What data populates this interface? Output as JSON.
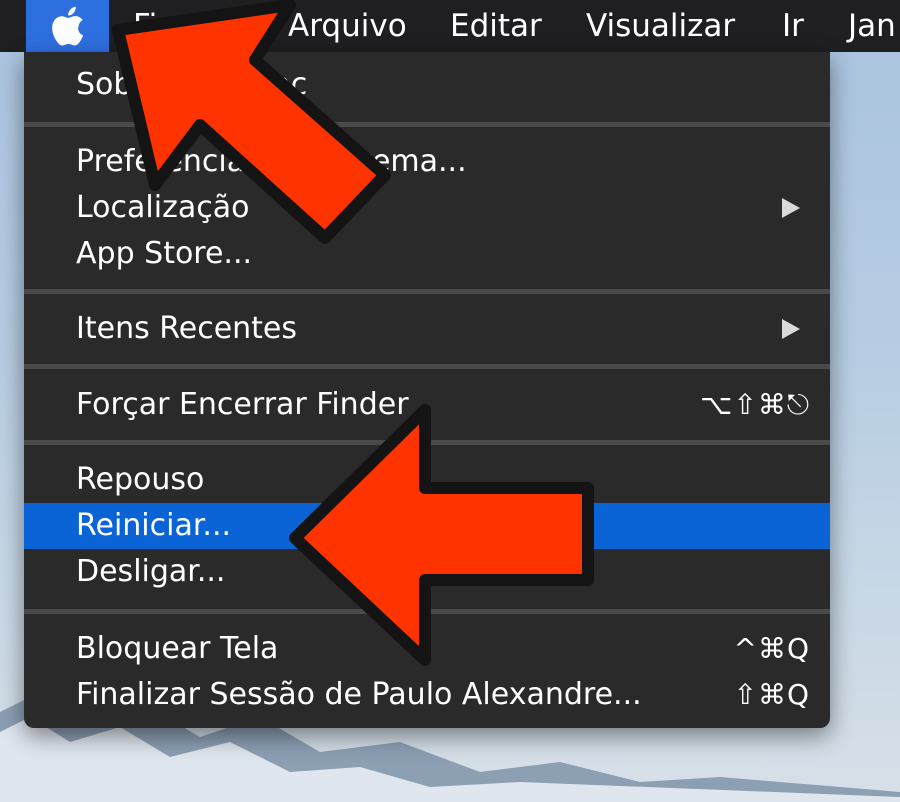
{
  "menubar": {
    "apple_icon": "apple-logo-icon",
    "items": [
      "Fi",
      "Arquivo",
      "Editar",
      "Visualizar",
      "Ir",
      "Jan"
    ]
  },
  "apple_menu": {
    "items": [
      {
        "label": "Sobre Este Mac"
      },
      {
        "label": "Preferências do Sistema..."
      },
      {
        "label": "Localização",
        "submenu": true
      },
      {
        "label": "App Store..."
      },
      {
        "label": "Itens Recentes",
        "submenu": true
      },
      {
        "label": "Forçar Encerrar Finder",
        "shortcut": "⌥⇧⌘⎋"
      },
      {
        "label": "Repouso"
      },
      {
        "label": "Reiniciar...",
        "highlighted": true
      },
      {
        "label": "Desligar..."
      },
      {
        "label": "Bloquear Tela",
        "shortcut": "^⌘Q"
      },
      {
        "label": "Finalizar Sessão de Paulo Alexandre...",
        "shortcut": "⇧⌘Q"
      }
    ]
  },
  "annotation": {
    "arrow_color": "#ff3300",
    "arrows": [
      "arrow-to-apple-menu",
      "arrow-to-reiniciar"
    ]
  },
  "colors": {
    "menubar_bg": "#1f1f21",
    "menu_bg": "#2a2a2a",
    "highlight": "#0a64d6",
    "apple_button": "#2e6fe0"
  }
}
